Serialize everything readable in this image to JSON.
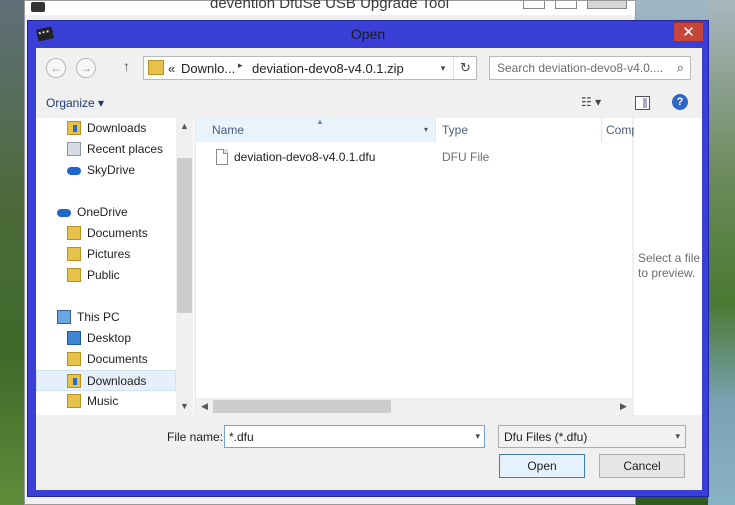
{
  "background_window": {
    "title": "devention DfuSe USB Upgrade Tool"
  },
  "dialog": {
    "title": "Open",
    "close_glyph": "✕"
  },
  "navigation": {
    "back_glyph": "←",
    "forward_glyph": "→",
    "up_glyph": "↑",
    "address_parts": [
      "«",
      "Downlo...",
      "deviation-devo8-v4.0.1.zip"
    ],
    "address_chevron": "▸",
    "dropdown_glyph": "▾",
    "refresh_glyph": "↻",
    "search_placeholder": "Search deviation-devo8-v4.0....",
    "search_glyph": "⌕"
  },
  "toolbar": {
    "organize_label": "Organize ▾",
    "views_glyph": "☷ ▾",
    "help_glyph": "?"
  },
  "nav_pane": {
    "items": [
      {
        "label": "Downloads",
        "icon": "downloads-folder-icon"
      },
      {
        "label": "Recent places",
        "icon": "recent-places-icon"
      },
      {
        "label": "SkyDrive",
        "icon": "cloud-icon"
      },
      {
        "label": "OneDrive",
        "icon": "cloud-icon"
      },
      {
        "label": "Documents",
        "icon": "folder-icon"
      },
      {
        "label": "Pictures",
        "icon": "folder-icon"
      },
      {
        "label": "Public",
        "icon": "folder-icon"
      },
      {
        "label": "This PC",
        "icon": "computer-icon"
      },
      {
        "label": "Desktop",
        "icon": "desktop-icon"
      },
      {
        "label": "Documents",
        "icon": "documents-icon"
      },
      {
        "label": "Downloads",
        "icon": "downloads-folder-icon",
        "selected": true
      },
      {
        "label": "Music",
        "icon": "music-icon"
      }
    ],
    "scroll_up_glyph": "▲",
    "scroll_down_glyph": "▼"
  },
  "file_list": {
    "columns": {
      "name": "Name",
      "type": "Type",
      "comp": "Comp"
    },
    "sort_glyph": "▲",
    "column_dd_glyph": "▾",
    "files": [
      {
        "name": "deviation-devo8-v4.0.1.dfu",
        "type": "DFU File"
      }
    ],
    "scroll_left_glyph": "◀",
    "scroll_right_glyph": "▶"
  },
  "preview": {
    "text": "Select a file to preview."
  },
  "bottom": {
    "file_name_label": "File name:",
    "file_name_value": "*.dfu",
    "file_type_value": "Dfu Files (*.dfu)",
    "open_label": "Open",
    "cancel_label": "Cancel"
  },
  "colors": {
    "dialog_frame": "#3a3fd8",
    "close_button": "#c7463c"
  }
}
